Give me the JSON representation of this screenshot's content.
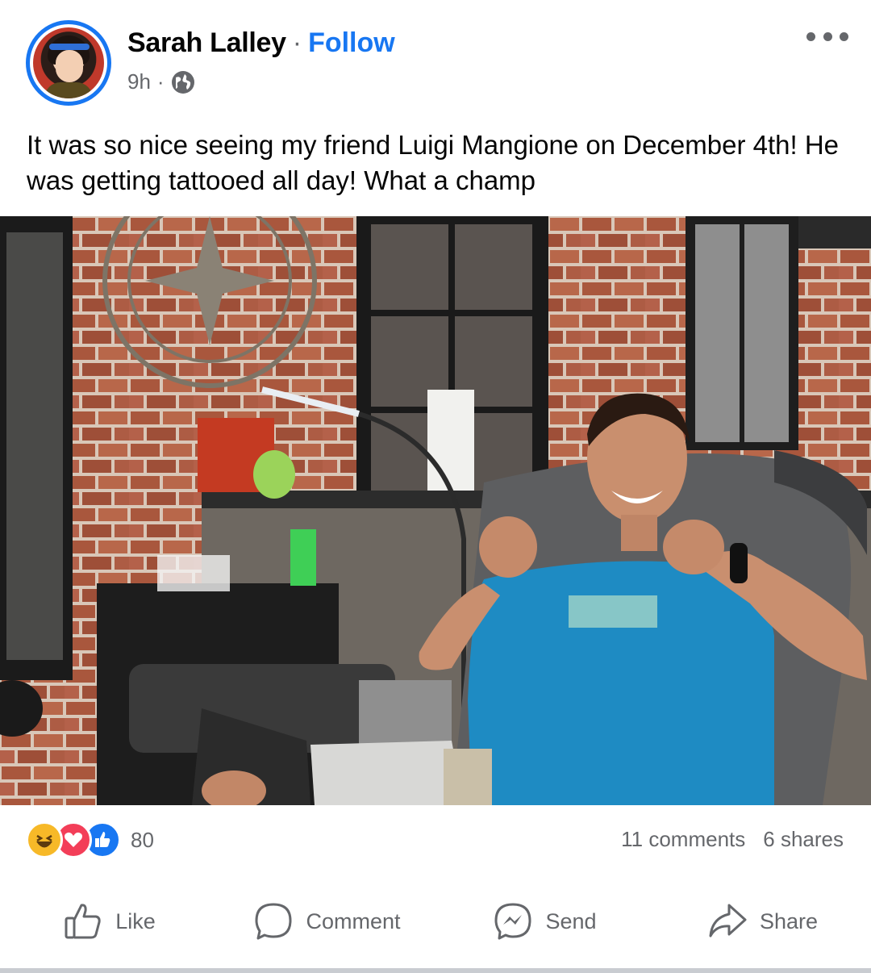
{
  "post": {
    "author": "Sarah Lalley",
    "separator": "·",
    "follow_label": "Follow",
    "time": "9h",
    "time_separator": "·",
    "audience_icon": "globe-icon",
    "caption": "It was so nice seeing my friend Luigi Mangione on December 4th! He was getting tattooed all day! What a champ"
  },
  "stats": {
    "reaction_icons": [
      "haha-icon",
      "love-icon",
      "like-icon"
    ],
    "reaction_count": "80",
    "comments": "11 comments",
    "shares": "6 shares"
  },
  "actions": [
    {
      "label": "Like",
      "icon": "thumbs-up-icon"
    },
    {
      "label": "Comment",
      "icon": "comment-bubble-icon"
    },
    {
      "label": "Send",
      "icon": "messenger-icon"
    },
    {
      "label": "Share",
      "icon": "share-arrow-icon"
    }
  ],
  "colors": {
    "accent": "#1877f2",
    "secondary_text": "#65676b",
    "primary_text": "#050505"
  }
}
